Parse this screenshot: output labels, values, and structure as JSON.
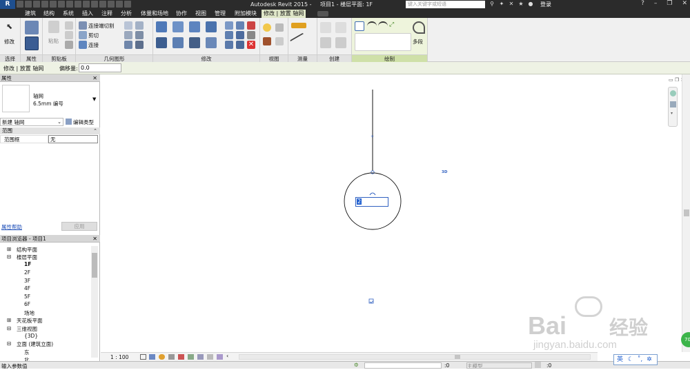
{
  "titlebar": {
    "app_title": "Autodesk Revit 2015 -",
    "doc_title": "项目1 - 楼层平面: 1F",
    "search_placeholder": "键入关键字或短语",
    "login_label": "登录"
  },
  "menu_tabs": [
    "建筑",
    "结构",
    "系统",
    "插入",
    "注释",
    "分析",
    "体量和场地",
    "协作",
    "视图",
    "管理",
    "附加模块",
    "修改 | 放置 轴网"
  ],
  "ribbon": {
    "panels": {
      "select": "选择",
      "properties": "属性",
      "clipboard": "剪贴板",
      "geometry": "几何图形",
      "modify": "修改",
      "view": "视图",
      "measure": "测量",
      "create": "创建",
      "draw": "绘制"
    },
    "modify_label": "修改",
    "paste_label": "粘贴",
    "cut_wall_label": "连接端切割",
    "cut_label": "剪切",
    "join_label": "连接",
    "multi_label": "多段"
  },
  "optbar": {
    "context": "修改 | 放置 轴网",
    "offset_label": "偏移量:",
    "offset_value": "0.0"
  },
  "properties": {
    "header": "属性",
    "type_name": "轴网",
    "type_sub": "6.5mm 编号",
    "new_selector": "新建 轴网",
    "edit_type": "编辑类型",
    "group": "范围",
    "param_name": "范围框",
    "param_value": "无",
    "help_link": "属性帮助",
    "apply_button": "应用"
  },
  "browser": {
    "header": "项目浏览器 - 项目1",
    "items": [
      "结构平面",
      "楼层平面",
      "1F",
      "2F",
      "3F",
      "4F",
      "5F",
      "6F",
      "场地",
      "天花板平面",
      "三维视图",
      "{3D}",
      "立面 (建筑立面)",
      "东",
      "北"
    ]
  },
  "canvas": {
    "grid_label_input": "2",
    "badge_3d": "3D"
  },
  "viewbar": {
    "scale": "1 : 100"
  },
  "status": {
    "message": "输入参数值",
    "zero_a": ":0",
    "model_label": "主模型",
    "zero_b": ":0"
  },
  "ime": {
    "lang": "英"
  },
  "watermark": {
    "brand": "Bai",
    "brand_cn": "经验",
    "url": "jingyan.baidu.com"
  }
}
